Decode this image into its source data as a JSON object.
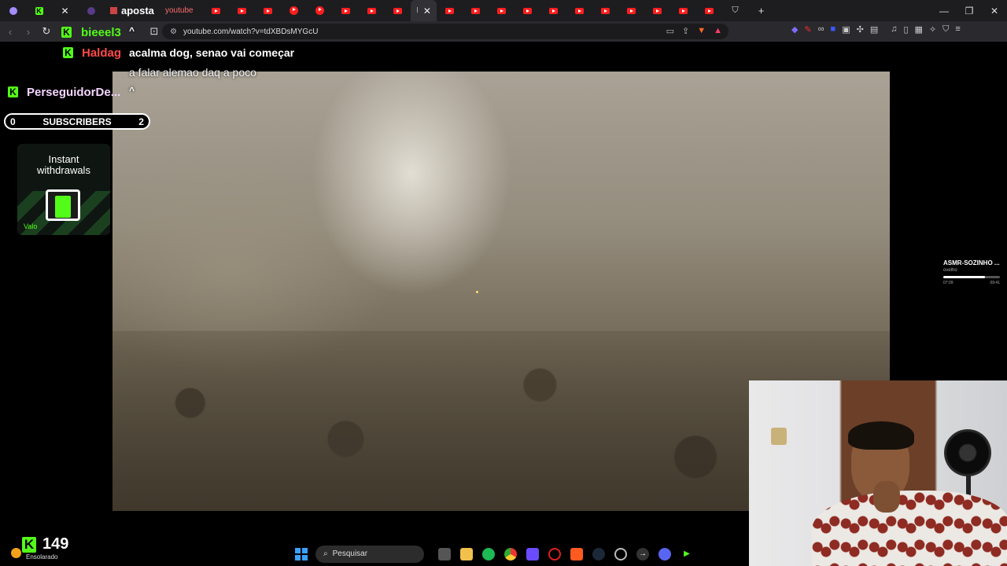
{
  "browser": {
    "tabs": [
      {
        "label": "",
        "icon": "tab-favicon-purple"
      },
      {
        "label": "",
        "icon": "kick-favicon"
      },
      {
        "label": "",
        "icon": "x-favicon"
      },
      {
        "label": "",
        "icon": "tab-favicon-purple"
      },
      {
        "label": "aposta",
        "icon": "tab-favicon"
      },
      {
        "label": "youtube",
        "icon": "tab-text"
      },
      {
        "label": "",
        "icon": "youtube-favicon"
      },
      {
        "label": "",
        "icon": "youtube-favicon"
      },
      {
        "label": "",
        "icon": "youtube-favicon"
      },
      {
        "label": "",
        "icon": "youtube-favicon"
      },
      {
        "label": "",
        "icon": "youtube-favicon"
      },
      {
        "label": "",
        "icon": "youtube-favicon"
      },
      {
        "label": "",
        "icon": "youtube-favicon"
      },
      {
        "label": "",
        "icon": "youtube-favicon"
      },
      {
        "label": "",
        "icon": "active-tab"
      },
      {
        "label": "",
        "icon": "youtube-favicon"
      },
      {
        "label": "",
        "icon": "youtube-favicon"
      },
      {
        "label": "",
        "icon": "youtube-favicon"
      },
      {
        "label": "",
        "icon": "youtube-favicon"
      },
      {
        "label": "",
        "icon": "youtube-favicon"
      },
      {
        "label": "",
        "icon": "youtube-favicon"
      },
      {
        "label": "",
        "icon": "youtube-favicon"
      },
      {
        "label": "",
        "icon": "youtube-favicon"
      },
      {
        "label": "",
        "icon": "youtube-favicon"
      },
      {
        "label": "",
        "icon": "youtube-favicon"
      },
      {
        "label": "",
        "icon": "youtube-favicon"
      },
      {
        "label": "",
        "icon": "youtube-favicon"
      },
      {
        "label": "",
        "icon": "youtube-favicon"
      },
      {
        "label": "",
        "icon": "youtube-favicon"
      }
    ],
    "url": "youtube.com/watch?v=tdXBDsMYGcU"
  },
  "chat": {
    "top_user": "bieeel3",
    "top_user_suffix": "^",
    "message_user": "Haldag",
    "message_line1": "acalma dog, senao vai começar",
    "message_line2": "a falar alemao daq a poco",
    "aposta_text": "aposta",
    "follower": "PerseguidorDe...",
    "follower_suffix": "^"
  },
  "subscribers": {
    "label": "SUBSCRIBERS",
    "start": "0",
    "goal": "2"
  },
  "ad": {
    "line1": "Instant",
    "line2": "withdrawals",
    "badge": "Valo"
  },
  "mini_player": {
    "title": "ASMR-SOZINHO ...",
    "subtitle": "ovelho",
    "time_start": "07:09",
    "time_end": "09:41",
    "progress": 0.74
  },
  "stream": {
    "viewer_count": "149"
  },
  "weather": {
    "label": "Ensolarado"
  },
  "taskbar": {
    "search_placeholder": "Pesquisar",
    "apps": [
      "task-view-icon",
      "file-explorer-icon",
      "spotify-icon",
      "chrome-icon",
      "app-grid-icon",
      "opera-icon",
      "brave-icon",
      "steam-icon",
      "settings-icon",
      "arrow-app-icon",
      "discord-icon",
      "kick-app-icon"
    ]
  },
  "colors": {
    "kick_green": "#53fc18",
    "haldag_red": "#ff4a4a",
    "youtube_red": "#ff1e1e"
  }
}
